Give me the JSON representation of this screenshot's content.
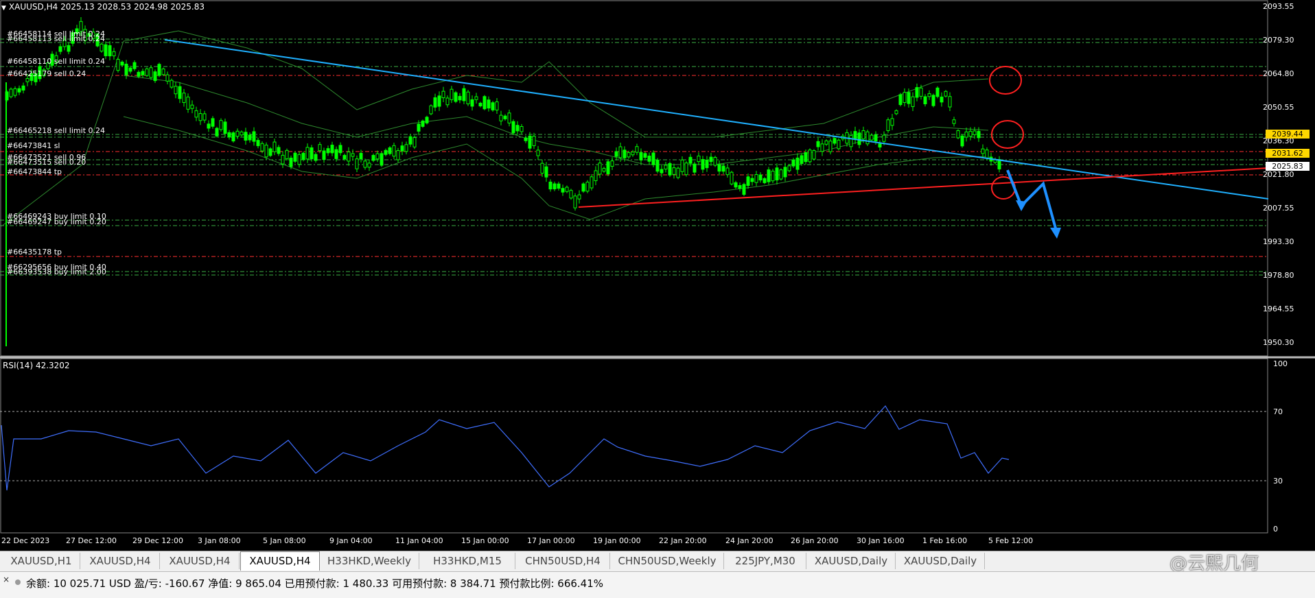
{
  "symbol_header": {
    "text": "XAUUSD,H4  2025.13 2028.53 2024.98 2025.83"
  },
  "order_labels": [
    "#66458114 sell limit 0.24",
    "#66458113 sell limit 0.24",
    "#66458110 sell limit 0.24",
    "#66425179 sell 0.24",
    "#66465218 sell limit 0.24",
    "#66473841 sl",
    "#66473521 sell 0.96",
    "#66473515 sell 0.20",
    "#66473844 tp",
    "#66469243 buy limit 0.10",
    "#66469247 buy limit 0.20",
    "#66435178 tp",
    "#66295656 buy limit 0.40",
    "#66393538 buy limit 2.00"
  ],
  "price_axis": {
    "ticks": [
      "2093.55",
      "2079.30",
      "2064.80",
      "2050.55",
      "2036.30",
      "2021.80",
      "2007.55",
      "1993.30",
      "1978.80",
      "1964.55",
      "1950.30"
    ],
    "badges": [
      {
        "text": "2039.44",
        "color": "#ffd700"
      },
      {
        "text": "2031.62",
        "color": "#ffd700"
      },
      {
        "text": "2025.83",
        "color": "#ffffff"
      }
    ]
  },
  "rsi": {
    "label": "RSI(14) 42.3202",
    "ticks": [
      "100",
      "70",
      "30",
      "0"
    ]
  },
  "time_axis": [
    "22 Dec 2023",
    "27 Dec 12:00",
    "29 Dec 12:00",
    "3 Jan 08:00",
    "5 Jan 08:00",
    "9 Jan 04:00",
    "11 Jan 04:00",
    "15 Jan 00:00",
    "17 Jan 00:00",
    "19 Jan 00:00",
    "22 Jan 20:00",
    "24 Jan 20:00",
    "26 Jan 20:00",
    "30 Jan 16:00",
    "1 Feb 16:00",
    "5 Feb 12:00"
  ],
  "tabs": [
    {
      "label": "XAUUSD,H1",
      "active": false
    },
    {
      "label": "XAUUSD,H4",
      "active": false
    },
    {
      "label": "XAUUSD,H4",
      "active": false
    },
    {
      "label": "XAUUSD,H4",
      "active": true
    },
    {
      "label": "H33HKD,Weekly",
      "active": false
    },
    {
      "label": "H33HKD,M15",
      "active": false
    },
    {
      "label": "CHN50USD,H4",
      "active": false
    },
    {
      "label": "CHN50USD,Weekly",
      "active": false
    },
    {
      "label": "225JPY,M30",
      "active": false
    },
    {
      "label": "XAUUSD,Daily",
      "active": false
    },
    {
      "label": "XAUUSD,Daily",
      "active": false
    }
  ],
  "status_bar": {
    "close_icon": "×",
    "text": "余额: 10 025.71 USD  盈/亏: -160.67  净值: 9 865.04  已用预付款: 1 480.33  可用预付款: 8 384.71  预付款比例: 666.41%"
  },
  "watermark": "@云熙几何",
  "colors": {
    "candle": "#00ff00",
    "bollinger": "#2e8b2e",
    "trendline_blue": "#1fb0ff",
    "trendline_red": "#ff2020",
    "rsi_line": "#3f6fff",
    "sell_level": "#ff3030",
    "buy_level": "#3cb043"
  }
}
